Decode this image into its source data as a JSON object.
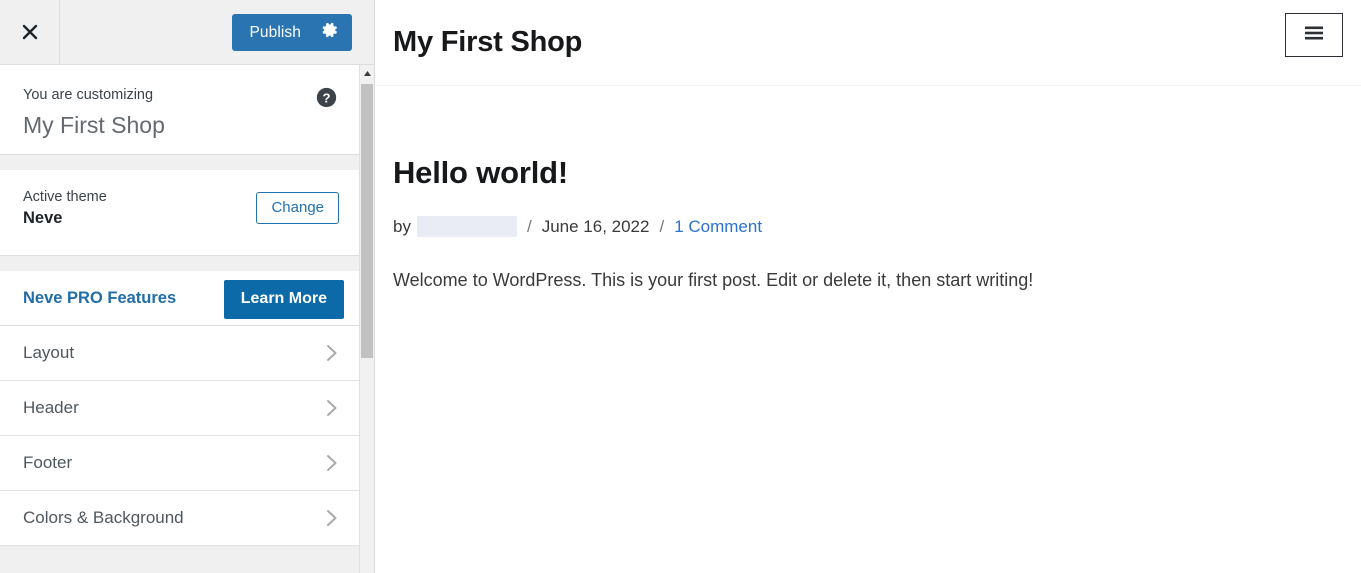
{
  "customizer": {
    "close_icon": "close-x-icon",
    "publish": {
      "label": "Publish",
      "settings_icon": "gear-icon",
      "color": "#2a74b1"
    },
    "panel": {
      "eyebrow": "You are customizing",
      "site_name": "My First Shop",
      "help_icon": "help-circle-icon"
    },
    "theme": {
      "label": "Active theme",
      "name": "Neve",
      "change_label": "Change",
      "change_color": "#2271b1"
    },
    "pro": {
      "label": "Neve PRO Features",
      "button_label": "Learn More",
      "button_color": "#0d6aa8",
      "label_color": "#1f6ea8"
    },
    "nav_items": [
      {
        "label": "Layout",
        "chevron": "chevron-right-icon"
      },
      {
        "label": "Header",
        "chevron": "chevron-right-icon"
      },
      {
        "label": "Footer",
        "chevron": "chevron-right-icon"
      },
      {
        "label": "Colors & Background",
        "chevron": "chevron-right-icon"
      }
    ],
    "scrollbar": {
      "up_arrow_icon": "scroll-up-arrow-icon",
      "thumb_color": "#c1c1c1"
    }
  },
  "preview": {
    "site_title": "My First Shop",
    "menu_icon": "hamburger-menu-icon",
    "post": {
      "title": "Hello world!",
      "by_label": "by",
      "author": "",
      "separator": "/",
      "date": "June 16, 2022",
      "comments_label": "1 Comment",
      "comments_color": "#2a72cf",
      "body": "Welcome to WordPress. This is your first post. Edit or delete it, then start writing!"
    }
  }
}
